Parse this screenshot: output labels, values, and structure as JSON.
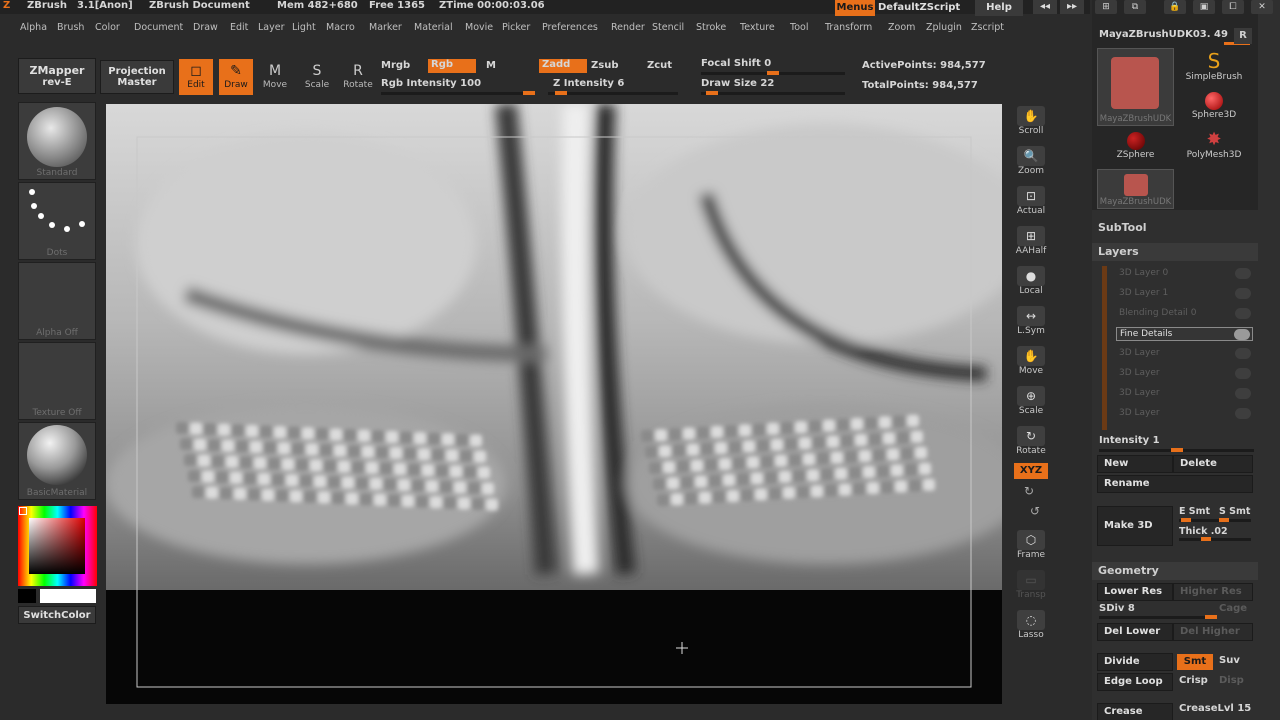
{
  "titlebar": {
    "app": "ZBrush",
    "version": "3.1[Anon]",
    "document": "ZBrush Document",
    "mem": "Mem 482+680",
    "free": "Free 1365",
    "ztime": "ZTime 00:00:03.06",
    "menus": "Menus",
    "default_zscript": "DefaultZScript",
    "help": "Help"
  },
  "menubar": [
    "Alpha",
    "Brush",
    "Color",
    "Document",
    "Draw",
    "Edit",
    "Layer",
    "Light",
    "Macro",
    "Marker",
    "Material",
    "Movie",
    "Picker",
    "Preferences",
    "Render",
    "Stencil",
    "Stroke",
    "Texture",
    "Tool",
    "Transform",
    "Zoom",
    "Zplugin",
    "Zscript"
  ],
  "shelf": {
    "zmapper_line1": "ZMapper",
    "zmapper_line2": "rev-E",
    "projection_line1": "Projection",
    "projection_line2": "Master",
    "tools": [
      {
        "label": "Edit",
        "icon": "edit-icon",
        "glyph": "◻"
      },
      {
        "label": "Draw",
        "icon": "draw-icon",
        "glyph": "✎"
      },
      {
        "label": "Move",
        "icon": "move-icon",
        "glyph": "M"
      },
      {
        "label": "Scale",
        "icon": "scale-icon",
        "glyph": "S"
      },
      {
        "label": "Rotate",
        "icon": "rotate-icon",
        "glyph": "R"
      }
    ],
    "mrgb": "Mrgb",
    "rgb": "Rgb",
    "m": "M",
    "rgb_intensity": "Rgb Intensity 100",
    "rgb_intensity_value": 100,
    "zadd": "Zadd",
    "zsub": "Zsub",
    "zcut": "Zcut",
    "z_intensity": "Z Intensity 6",
    "z_intensity_value": 6,
    "focal_shift": "Focal Shift 0",
    "focal_shift_value": 0,
    "draw_size": "Draw Size 22",
    "draw_size_value": 22,
    "active_points": "ActivePoints: 984,577",
    "total_points": "TotalPoints: 984,577"
  },
  "lefttray": {
    "brush": "Standard",
    "stroke": "Dots",
    "alpha": "Alpha Off",
    "texture": "Texture Off",
    "material": "BasicMaterial",
    "switch_color": "SwitchColor"
  },
  "dock": [
    {
      "label": "Scroll",
      "icon": "scroll-icon",
      "glyph": "✋"
    },
    {
      "label": "Zoom",
      "icon": "zoom-icon",
      "glyph": "🔍"
    },
    {
      "label": "Actual",
      "icon": "actual-icon",
      "glyph": "⊡"
    },
    {
      "label": "AAHalf",
      "icon": "aahalf-icon",
      "glyph": "⊞"
    },
    {
      "label": "Local",
      "icon": "local-icon",
      "glyph": "●"
    },
    {
      "label": "L.Sym",
      "icon": "lsym-icon",
      "glyph": "↔"
    },
    {
      "label": "Move",
      "icon": "move-icon",
      "glyph": "✋"
    },
    {
      "label": "Scale",
      "icon": "scale-icon",
      "glyph": "⊕"
    },
    {
      "label": "Rotate",
      "icon": "rotate-icon",
      "glyph": "↻"
    }
  ],
  "dock_extra": {
    "xyz": "XYZ",
    "frame": "Frame",
    "transp": "Transp",
    "lasso": "Lasso"
  },
  "rpanel": {
    "tool_name": "MayaZBrushUDK03. 49",
    "r": "R",
    "tools": [
      {
        "label": "MayaZBrushUDK"
      },
      {
        "label": "SimpleBrush"
      },
      {
        "label": "Sphere3D"
      },
      {
        "label": "ZSphere"
      },
      {
        "label": "PolyMesh3D"
      },
      {
        "label": "MayaZBrushUDK"
      }
    ],
    "subtool": "SubTool",
    "layers_title": "Layers",
    "layers": [
      "3D Layer 0",
      "3D Layer 1",
      "Blending Detail 0",
      "Fine Details",
      "3D Layer",
      "3D Layer",
      "3D Layer",
      "3D Layer"
    ],
    "selected_layer": 3,
    "intensity": "Intensity 1",
    "intensity_value": 1,
    "new": "New",
    "delete": "Delete",
    "rename": "Rename",
    "make3d": "Make 3D",
    "esmt": "E Smt",
    "ssmt": "S Smt",
    "thick": "Thick .02",
    "geometry_title": "Geometry",
    "lower_res": "Lower Res",
    "higher_res": "Higher Res",
    "sdiv": "SDiv 8",
    "sdiv_value": 8,
    "cage": "Cage",
    "del_lower": "Del Lower",
    "del_higher": "Del Higher",
    "divide": "Divide",
    "smt": "Smt",
    "suv": "Suv",
    "edge_loop": "Edge Loop",
    "crisp": "Crisp",
    "disp": "Disp",
    "crease": "Crease",
    "creaselvl": "CreaseLvl 15"
  },
  "colors": {
    "accent": "#e8701a",
    "panel": "#2f2f2f",
    "background": "#2b2b2b"
  }
}
